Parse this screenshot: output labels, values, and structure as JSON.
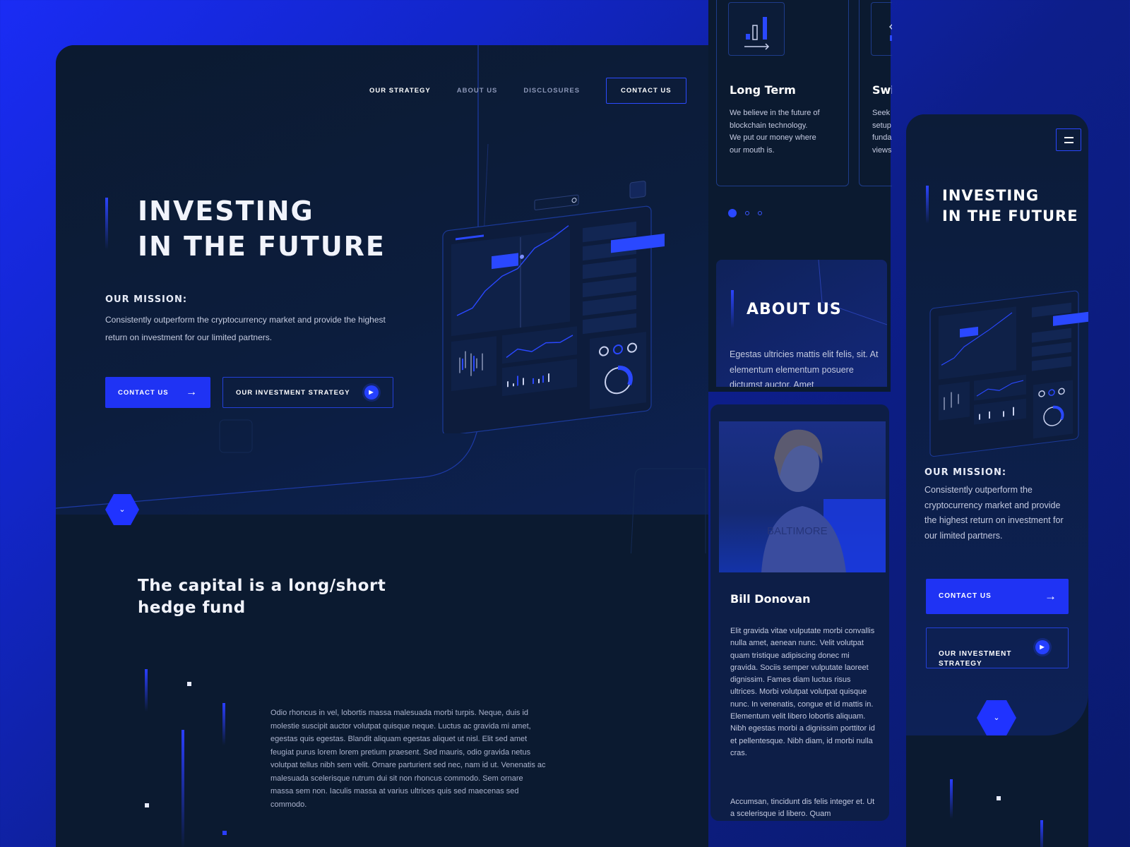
{
  "nav": {
    "items": [
      "OUR STRATEGY",
      "ABOUT US",
      "DISCLOSURES"
    ],
    "contact": "CONTACT US"
  },
  "hero": {
    "title": "INVESTING\nIN THE FUTURE",
    "mission_heading": "OUR MISSION:",
    "mission_text": "Consistently outperform the cryptocurrency market and provide the highest return on investment for our limited partners.",
    "cta_primary": "CONTACT US",
    "cta_secondary": "OUR INVESTMENT STRATEGY"
  },
  "capital": {
    "heading": "The capital is a long/short\nhedge fund",
    "body": "Odio rhoncus in vel, lobortis massa malesuada morbi turpis. Neque, duis id molestie suscipit auctor volutpat quisque neque. Luctus ac gravida mi amet, egestas quis egestas. Blandit aliquam egestas aliquet ut nisl. Elit sed amet feugiat purus lorem lorem pretium praesent. Sed mauris, odio gravida netus volutpat tellus nibh sem velit. Ornare parturient sed nec, nam id ut. Venenatis ac malesuada scelerisque rutrum dui sit non rhoncus commodo. Sem ornare massa sem non. Iaculis massa at varius ultrices quis sed maecenas sed commodo."
  },
  "strategy_cards": [
    {
      "title": "Long Term",
      "text": "We believe in the future of\nblockchain technology.\nWe put our money where\nour mouth is."
    },
    {
      "title": "Swi",
      "text": "Seek\nsetup\nfunda\nviews"
    }
  ],
  "about": {
    "title": "ABOUT US",
    "text": "Egestas ultricies mattis elit felis, sit. At elementum elementum posuere dictumst auctor. Amet"
  },
  "team_member": {
    "name": "Bill Donovan",
    "shirt_text": "BALTIMORE",
    "bio": "Elit gravida vitae vulputate morbi convallis nulla amet, aenean nunc. Velit volutpat quam tristique adipiscing donec mi gravida. Sociis semper vulputate laoreet dignissim. Fames diam luctus risus ultrices. Morbi volutpat volutpat quisque nunc. In venenatis, congue et id mattis in. Elementum velit libero lobortis aliquam. Nibh egestas morbi a dignissim porttitor id et pellentesque. Nibh diam, id morbi nulla cras.",
    "bio2": "Accumsan, tincidunt dis felis integer et. Ut a scelerisque id libero. Quam"
  },
  "mobile": {
    "title": "INVESTING\nIN THE FUTURE",
    "mission_heading": "OUR MISSION:",
    "mission_text": "Consistently outperform the cryptocurrency market and provide the highest return on investment for our limited partners.",
    "cta_primary": "CONTACT US",
    "cta_secondary": "OUR INVESTMENT\nSTRATEGY"
  },
  "icons": {
    "arrow": "→",
    "play": "▶",
    "chevron": "⌄"
  },
  "colors": {
    "accent": "#1f33f4",
    "bg_dark": "#0b1a30",
    "outer_gradient": "#1a2cf5"
  }
}
